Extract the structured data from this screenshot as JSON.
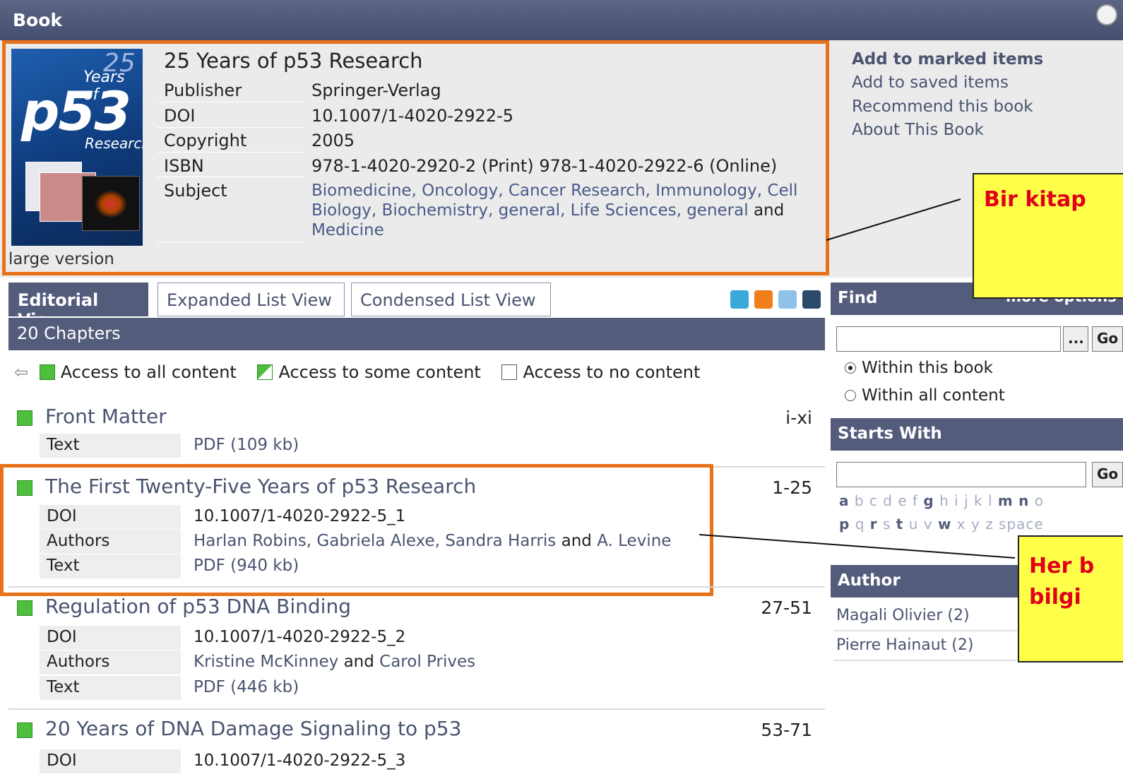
{
  "header": {
    "title": "Book"
  },
  "book": {
    "title": "25 Years of p53 Research",
    "large_version": "large version",
    "cover": {
      "num": "25",
      "years": "Years of",
      "p53": "p53",
      "research": "Research"
    },
    "meta": [
      {
        "label": "Publisher",
        "value": "Springer-Verlag"
      },
      {
        "label": "DOI",
        "value": "10.1007/1-4020-2922-5"
      },
      {
        "label": "Copyright",
        "value": "2005"
      },
      {
        "label": "ISBN",
        "value": "978-1-4020-2920-2 (Print) 978-1-4020-2922-6 (Online)"
      },
      {
        "label": "Subject",
        "value": ""
      }
    ],
    "subjects": {
      "line1": "Biomedicine, Oncology, Cancer Research, Immunology, Cell",
      "line2a": "Biology, Biochemistry, general, Life Sciences, general",
      "and": "and",
      "line3": "Medicine"
    }
  },
  "actions": [
    "Add to marked items",
    "Add to saved items",
    "Recommend this book",
    "About This Book"
  ],
  "callouts": {
    "first": "Bir kitap",
    "second_line1": "Her b",
    "second_line2": "bilgi"
  },
  "tabs": [
    "Editorial View",
    "Expanded List View",
    "Condensed List View"
  ],
  "toolbar_icons": [
    "add-alert-icon",
    "rss-icon",
    "email-icon",
    "save-icon"
  ],
  "chapters_count": "20 Chapters",
  "legend": {
    "all": "Access to all content",
    "some": "Access to some content",
    "none": "Access to no content"
  },
  "chapters": [
    {
      "title": "Front Matter",
      "pages": "i-xi",
      "rows": [
        {
          "label": "Text",
          "value": "PDF (109 kb)"
        }
      ]
    },
    {
      "title": "The First Twenty-Five Years of p53 Research",
      "pages": "1-25",
      "rows": [
        {
          "label": "DOI",
          "value": "10.1007/1-4020-2922-5_1"
        },
        {
          "label": "Authors",
          "value": "Harlan Robins, Gabriela Alexe, Sandra Harris",
          "and": "and",
          "value2": "A. Levine"
        },
        {
          "label": "Text",
          "value": "PDF (940 kb)"
        }
      ]
    },
    {
      "title": "Regulation of p53 DNA Binding",
      "pages": "27-51",
      "rows": [
        {
          "label": "DOI",
          "value": "10.1007/1-4020-2922-5_2"
        },
        {
          "label": "Authors",
          "value": "Kristine McKinney",
          "and": "and",
          "value2": "Carol Prives"
        },
        {
          "label": "Text",
          "value": "PDF (446 kb)"
        }
      ]
    },
    {
      "title": "20 Years of DNA Damage Signaling to p53",
      "pages": "53-71",
      "rows": [
        {
          "label": "DOI",
          "value": "10.1007/1-4020-2922-5_3"
        }
      ]
    }
  ],
  "find": {
    "heading": "Find",
    "more": "more options",
    "dots": "...",
    "go": "Go",
    "radio_book": "Within this book",
    "radio_all": "Within all content"
  },
  "starts_with": {
    "heading": "Starts With",
    "go": "Go",
    "letters_row1": [
      "a",
      "b",
      "c",
      "d",
      "e",
      "f",
      "g",
      "h",
      "i",
      "j",
      "k",
      "l",
      "m",
      "n",
      "o"
    ],
    "letters_row2": [
      "p",
      "q",
      "r",
      "s",
      "t",
      "u",
      "v",
      "w",
      "x",
      "y",
      "z",
      "space"
    ]
  },
  "author": {
    "heading": "Author",
    "items": [
      "Magali Olivier (2)",
      "Pierre Hainaut (2)"
    ]
  },
  "colors": {
    "header": "#545c7c",
    "access_green": "#4dbf3c",
    "highlight": "#e8721a",
    "callout_bg": "#ffff4a",
    "callout_text": "#e0001a"
  }
}
